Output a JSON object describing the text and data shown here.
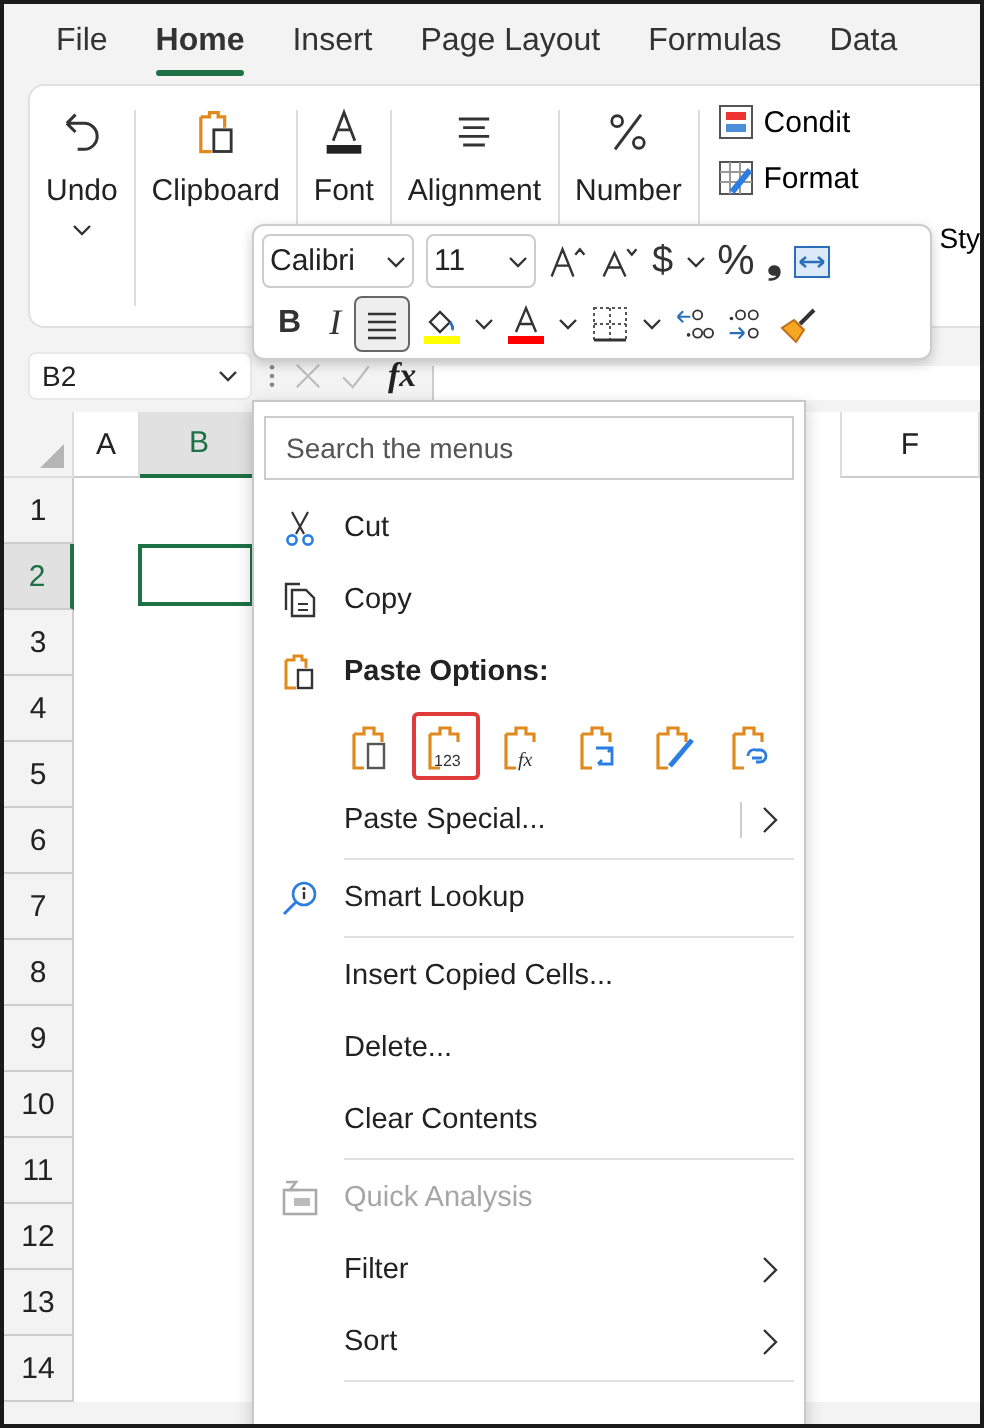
{
  "ribbon_tabs": [
    {
      "label": "File",
      "selected": false
    },
    {
      "label": "Home",
      "selected": true
    },
    {
      "label": "Insert",
      "selected": false
    },
    {
      "label": "Page Layout",
      "selected": false
    },
    {
      "label": "Formulas",
      "selected": false
    },
    {
      "label": "Data",
      "selected": false
    }
  ],
  "ribbon_groups": [
    {
      "kind": "undo",
      "label": "Undo"
    },
    {
      "kind": "clipboard",
      "label": "Clipboard"
    },
    {
      "kind": "font",
      "label": "Font"
    },
    {
      "kind": "alignment",
      "label": "Alignment"
    },
    {
      "kind": "number",
      "label": "Number"
    }
  ],
  "styles_commands": [
    {
      "kind": "conditional",
      "label": "Condit"
    },
    {
      "kind": "format_table",
      "label": "Format"
    },
    {
      "kind": "cell_styles",
      "label": "Sty"
    }
  ],
  "mini_toolbar": {
    "font": "Calibri",
    "size": "11",
    "currency": "$",
    "percent": "%",
    "comma": "❟",
    "bold": "B",
    "italic": "I",
    "center_pressed": true
  },
  "name_box": "B2",
  "formula_label": "fx",
  "columns": [
    {
      "label": "A",
      "selected": false
    },
    {
      "label": "B",
      "selected": true
    },
    {
      "label": "F",
      "selected": false
    }
  ],
  "rows": [
    {
      "label": "1",
      "selected": false
    },
    {
      "label": "2",
      "selected": true
    },
    {
      "label": "3",
      "selected": false
    },
    {
      "label": "4",
      "selected": false
    },
    {
      "label": "5",
      "selected": false
    },
    {
      "label": "6",
      "selected": false
    },
    {
      "label": "7",
      "selected": false
    },
    {
      "label": "8",
      "selected": false
    },
    {
      "label": "9",
      "selected": false
    },
    {
      "label": "10",
      "selected": false
    },
    {
      "label": "11",
      "selected": false
    },
    {
      "label": "12",
      "selected": false
    },
    {
      "label": "13",
      "selected": false
    },
    {
      "label": "14",
      "selected": false
    }
  ],
  "context_menu": {
    "search": {
      "placeholder": "Search the menus"
    },
    "items": [
      {
        "kind": "cut",
        "label": "Cut",
        "disabled": false,
        "submenu": false
      },
      {
        "kind": "copy",
        "label": "Copy",
        "disabled": false,
        "submenu": false
      },
      {
        "kind": "header",
        "label": "Paste Options:"
      },
      {
        "kind": "paste_options",
        "options": [
          {
            "kind": "paste",
            "selected": false
          },
          {
            "kind": "values",
            "label": "123",
            "selected": true
          },
          {
            "kind": "formulas",
            "label": "fx",
            "selected": false
          },
          {
            "kind": "transpose",
            "selected": false
          },
          {
            "kind": "formatting",
            "selected": false
          },
          {
            "kind": "link",
            "selected": false
          }
        ]
      },
      {
        "kind": "item",
        "label": "Paste Special...",
        "disabled": false,
        "submenu": true,
        "split": true
      },
      {
        "kind": "separator"
      },
      {
        "kind": "lookup",
        "label": "Smart Lookup",
        "disabled": false,
        "submenu": false
      },
      {
        "kind": "separator"
      },
      {
        "kind": "item",
        "label": "Insert Copied Cells...",
        "disabled": false,
        "submenu": false
      },
      {
        "kind": "item",
        "label": "Delete...",
        "disabled": false,
        "submenu": false
      },
      {
        "kind": "item",
        "label": "Clear Contents",
        "disabled": false,
        "submenu": false
      },
      {
        "kind": "separator"
      },
      {
        "kind": "analysis",
        "label": "Quick Analysis",
        "disabled": true,
        "submenu": false
      },
      {
        "kind": "item",
        "label": "Filter",
        "disabled": false,
        "submenu": true
      },
      {
        "kind": "item",
        "label": "Sort",
        "disabled": false,
        "submenu": true
      },
      {
        "kind": "separator"
      }
    ]
  }
}
